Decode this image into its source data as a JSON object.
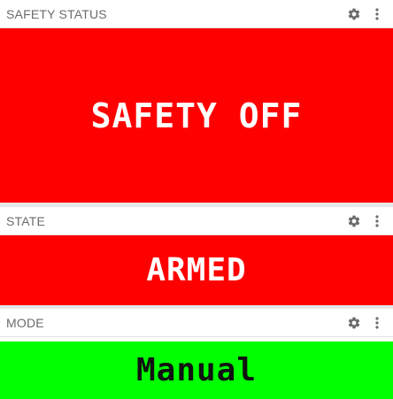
{
  "panels": [
    {
      "title": "SAFETY STATUS",
      "value": "SAFETY OFF",
      "background": "#ff0000",
      "text_color": "#ffffff"
    },
    {
      "title": "STATE",
      "value": "ARMED",
      "background": "#ff0000",
      "text_color": "#ffffff"
    },
    {
      "title": "MODE",
      "value": "Manual",
      "background": "#00ff00",
      "text_color": "#111111"
    }
  ],
  "icons": {
    "settings": "gear-icon",
    "menu": "vertical-ellipsis-icon"
  }
}
